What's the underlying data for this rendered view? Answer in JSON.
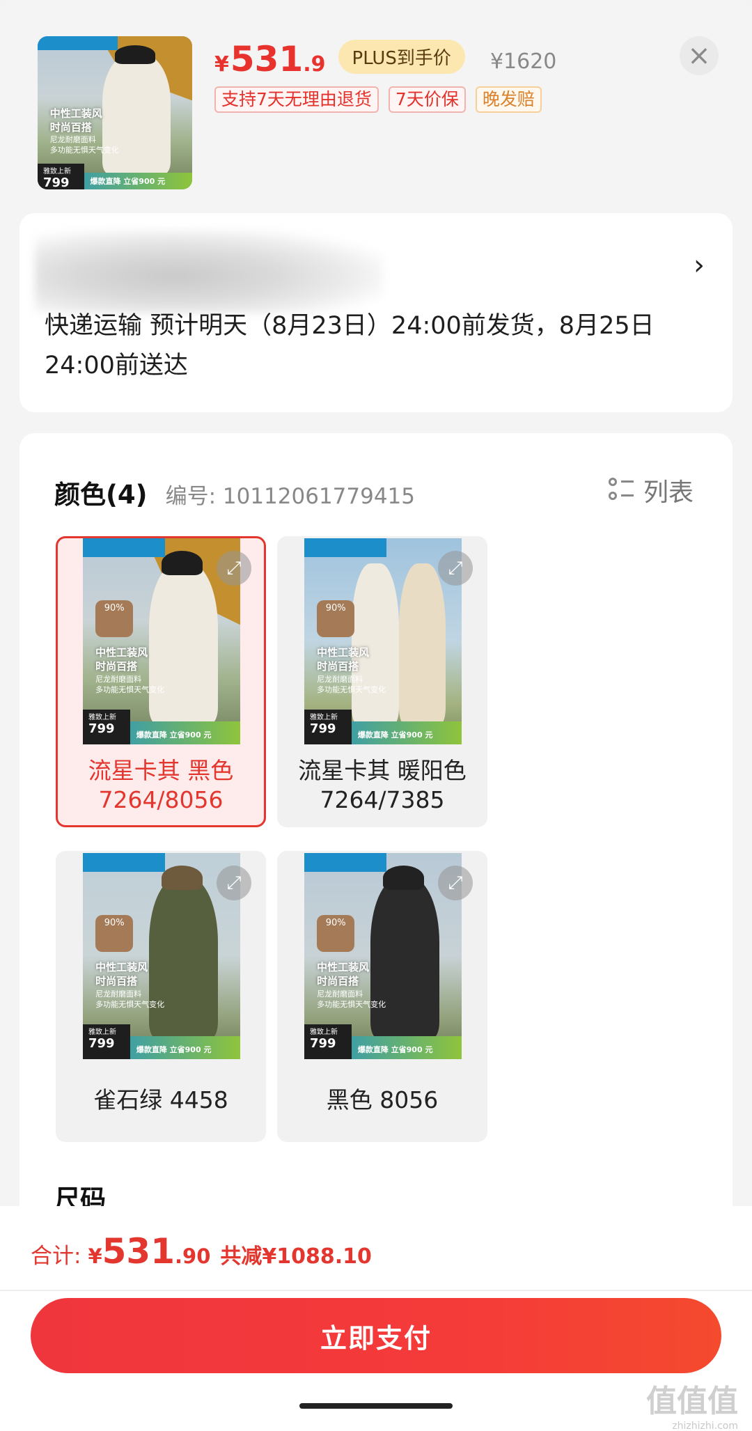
{
  "header": {
    "price_currency": "¥",
    "price_int": "531",
    "price_dec": ".9",
    "plus_badge": "PLUS到手价",
    "original_price": "¥1620",
    "tags": [
      "支持7天无理由退货",
      "7天价保",
      "晚发赔"
    ],
    "close_icon": "close-icon"
  },
  "thumbnail": {
    "slogan_1": "中性工装风",
    "slogan_2": "时尚百搭",
    "sub_1": "尼龙耐磨面料",
    "sub_2": "多功能无惧天气变化",
    "price_label": "雅致上新",
    "price": "799",
    "promo": "爆款直降 立省900 元"
  },
  "shipping": {
    "text": "快递运输 预计明天（8月23日）24:00前发货，8月25日24:00前送达",
    "arrow": "›"
  },
  "color_section": {
    "title": "颜色(4)",
    "sku_label": "编号: 10112061779415",
    "list_toggle": "列表",
    "variants": [
      {
        "line1": "流星卡其 黑色",
        "line2": "7264/8056",
        "selected": true
      },
      {
        "line1": "流星卡其 暖阳色",
        "line2": "7264/7385",
        "selected": false
      },
      {
        "line1": "雀石绿 4458",
        "line2": "",
        "selected": false
      },
      {
        "line1": "黑色 8056",
        "line2": "",
        "selected": false
      }
    ]
  },
  "size_section": {
    "title": "尺码"
  },
  "footer": {
    "total_label": "合计:",
    "total_currency": "¥",
    "total_int": "531",
    "total_dec": ".90",
    "discount": "共减¥1088.10",
    "pay_button": "立即支付"
  },
  "watermark": {
    "text": "值值值",
    "sub": "zhizhizhi.com"
  },
  "colors": {
    "accent_red": "#e2362f",
    "plus_gold": "#fce7b0"
  }
}
